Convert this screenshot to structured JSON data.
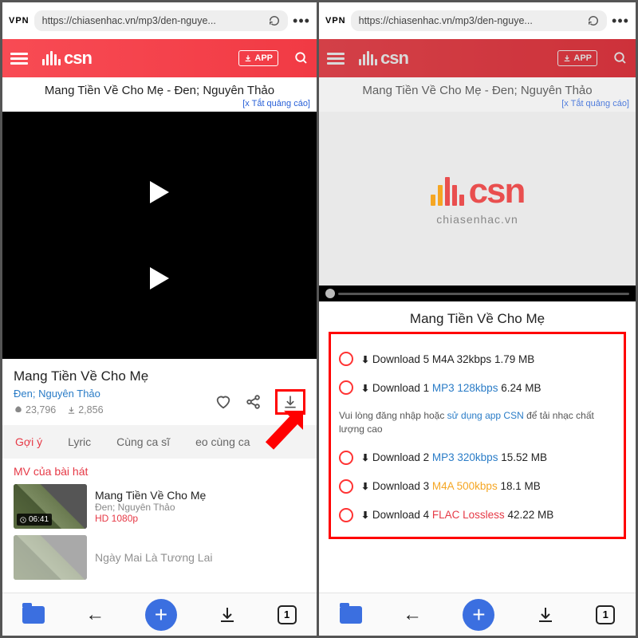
{
  "browser": {
    "vpn": "VPN",
    "url": "https://chiasenhac.vn/mp3/den-nguye...",
    "tabs_count": "1"
  },
  "header": {
    "brand": "csn",
    "app_button": "APP"
  },
  "page": {
    "title_bar": "Mang Tiền Về Cho Mẹ - Đen; Nguyên Thảo",
    "close_ad": "[x Tắt quảng cáo]"
  },
  "song": {
    "title": "Mang Tiền Về Cho Mẹ",
    "artists": "Đen; Nguyên Thảo",
    "listens": "23,796",
    "downloads": "2,856"
  },
  "tabs": {
    "suggest": "Gợi ý",
    "lyric": "Lyric",
    "same_artist": "Cùng ca sĩ",
    "video_same": "eo cùng ca"
  },
  "mv": {
    "section_label": "MV của bài hát",
    "item1_title": "Mang Tiền Về Cho Mẹ",
    "item1_artists": "Đen; Nguyên Thảo",
    "item1_quality": "HD 1080p",
    "item1_duration": "06:41",
    "item2_title": "Ngày Mai Là Tương Lai"
  },
  "right": {
    "brand_sub": "chiasenhac.vn",
    "modal_title": "Mang Tiền Về Cho Mẹ",
    "login_note_pre": "Vui lòng đăng nhập hoặc ",
    "login_note_link": "sử dụng app CSN",
    "login_note_post": " để tải nhạc chất lượng cao",
    "downloads": [
      {
        "pre": "Download 5 ",
        "fmt": "M4A 32kbps",
        "cls": "",
        "size": " 1.79 MB"
      },
      {
        "pre": "Download 1 ",
        "fmt": "MP3 128kbps",
        "cls": "fmt-blue",
        "size": " 6.24 MB"
      },
      {
        "pre": "Download 2 ",
        "fmt": "MP3 320kbps",
        "cls": "fmt-blue",
        "size": " 15.52 MB"
      },
      {
        "pre": "Download 3 ",
        "fmt": "M4A 500kbps",
        "cls": "fmt-orange",
        "size": " 18.1 MB"
      },
      {
        "pre": "Download 4 ",
        "fmt": "FLAC Lossless",
        "cls": "fmt-red",
        "size": " 42.22 MB"
      }
    ]
  }
}
